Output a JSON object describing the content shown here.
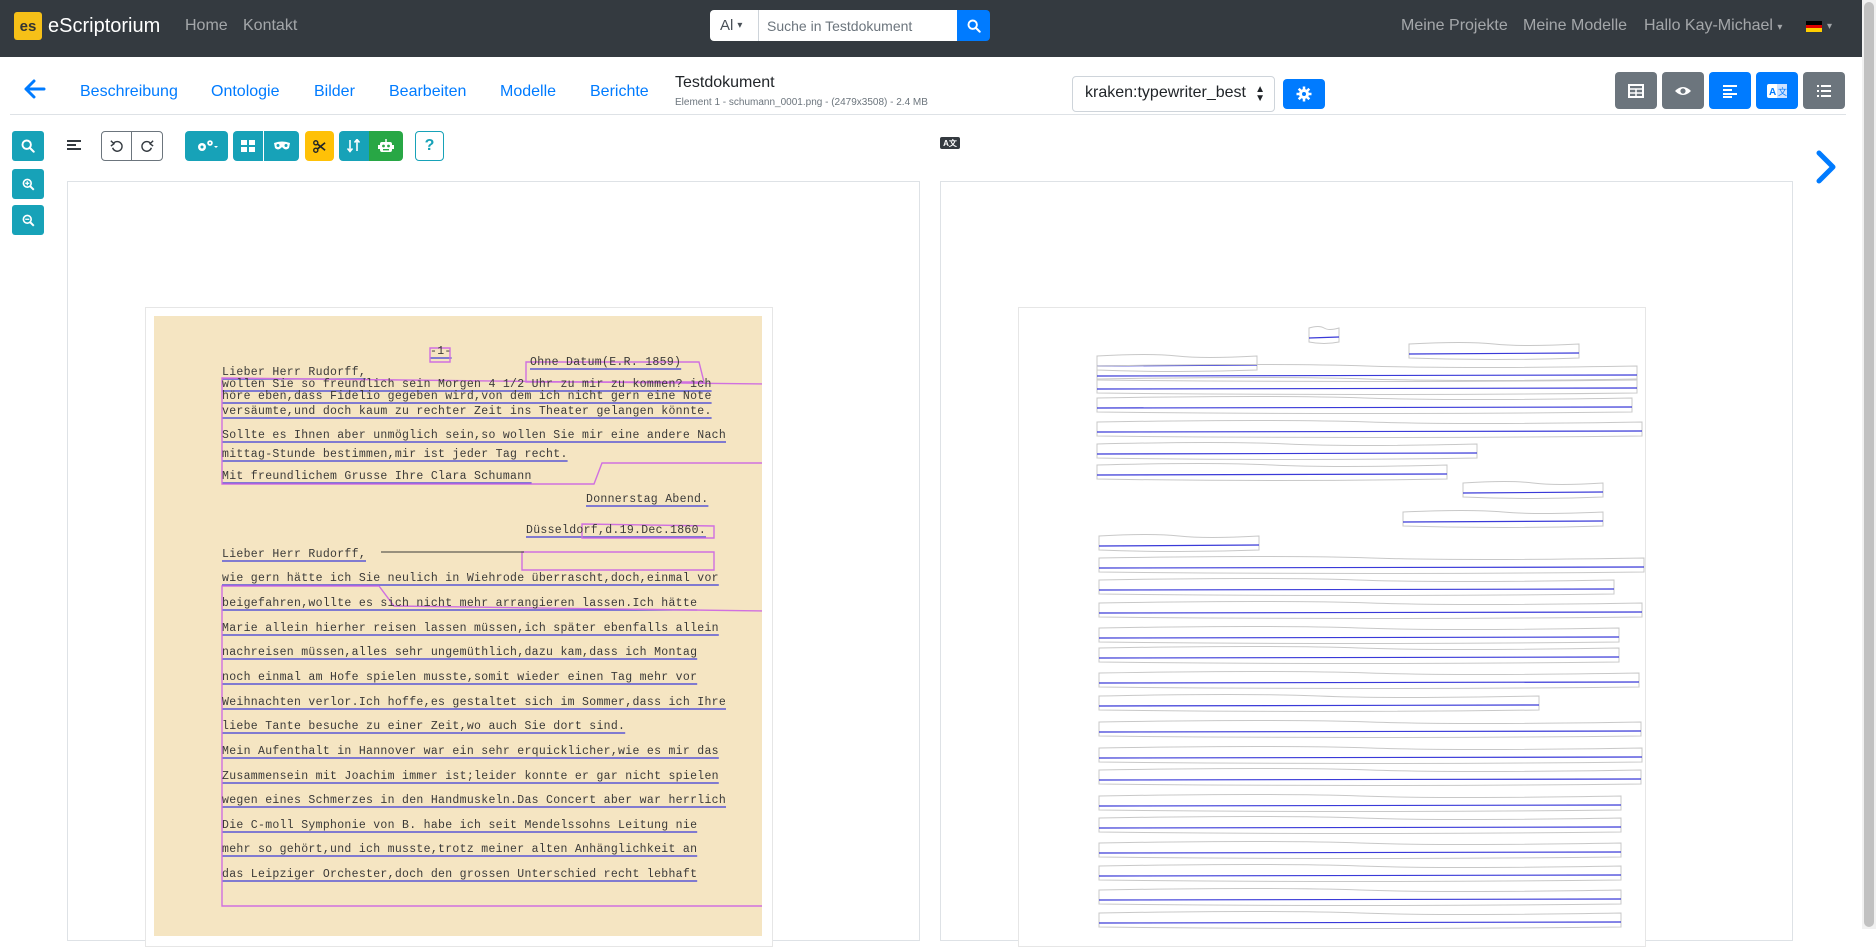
{
  "navbar": {
    "brand_logo": "es",
    "brand_name": "eScriptorium",
    "links": [
      "Home",
      "Kontakt"
    ],
    "search": {
      "scope": "Al",
      "placeholder": "Suche in Testdokument"
    },
    "right": {
      "projects": "Meine Projekte",
      "models": "Meine Modelle",
      "user": "Hallo Kay-Michael"
    }
  },
  "tabs": {
    "items": [
      "Beschreibung",
      "Ontologie",
      "Bilder",
      "Bearbeiten",
      "Modelle",
      "Berichte"
    ]
  },
  "document": {
    "title": "Testdokument",
    "meta": "Element 1 - schumann_0001.png - (2479x3508) - 2.4 MB"
  },
  "model_select": {
    "value": "kraken:typewriter_best"
  },
  "ab_label": "A文",
  "transcription": {
    "lines": [
      "-1-",
      "Ohne Datum(E.R. 1859)",
      "Lieber Herr Rudorff,",
      "wollen Sie so freundlich sein Morgen 4 1/2 Uhr zu mir zu kommen? ich",
      "höre eben,dass Fidelio gegeben wird,von dem ich nicht gern eine Note",
      "versäumte,und doch kaum zu rechter Zeit ins Theater gelangen könnte.",
      "Sollte es Ihnen aber unmöglich sein,so wollen Sie mir eine andere Nach",
      "mittag-Stunde bestimmen,mir ist jeder Tag recht.",
      "Mit freundlichem Grusse Ihre Clara Schumann",
      "Donnerstag Abend.",
      "Düsseldorf,d.19.Dec.1860.",
      "Lieber Herr Rudorff,",
      "wie gern hätte ich Sie neulich in Wiehrode überrascht,doch,einmal vor",
      "beigefahren,wollte es sich nicht mehr arrangieren lassen.Ich hätte",
      "Marie allein hierher reisen lassen müssen,ich später ebenfalls allein",
      "nachreisen müssen,alles sehr ungemüthlich,dazu kam,dass ich Montag",
      "noch einmal am Hofe spielen musste,somit wieder einen Tag mehr vor",
      "Weihnachten verlor.Ich hoffe,es gestaltet sich im Sommer,dass ich Ihre",
      "liebe Tante besuche zu einer Zeit,wo auch Sie dort sind.",
      "Mein Aufenthalt in Hannover war ein sehr erquicklicher,wie es mir das",
      "Zusammensein mit Joachim immer ist;leider konnte er gar nicht spielen",
      "wegen eines Schmerzes in den Handmuskeln.Das Concert aber war herrlich",
      "Die C-moll Symphonie von B. habe ich seit Mendelssohns Leitung nie",
      "mehr so gehört,und ich musste,trotz meiner alten Anhänglichkeit an",
      "das Leipziger Orchester,doch den grossen Unterschied recht lebhaft"
    ]
  },
  "colors": {
    "navbar": "#343a40",
    "primary": "#007bff",
    "info": "#17a2b8",
    "warning": "#ffc107",
    "success": "#28a745",
    "secondary": "#6c757d",
    "region_outline": "#d070e0",
    "baseline": "#3a3ad8"
  },
  "icons": [
    "logo-icon",
    "search-icon",
    "back-arrow-icon",
    "gear-icon",
    "table-icon",
    "eye-icon",
    "align-left-icon",
    "translate-icon",
    "list-ol-icon",
    "zoom-in-icon",
    "zoom-out-icon",
    "undo-icon",
    "redo-icon",
    "cogs-icon",
    "grid-icon",
    "mask-icon",
    "scissors-icon",
    "sort-icon",
    "robot-icon",
    "question-icon",
    "chevron-right-icon"
  ]
}
